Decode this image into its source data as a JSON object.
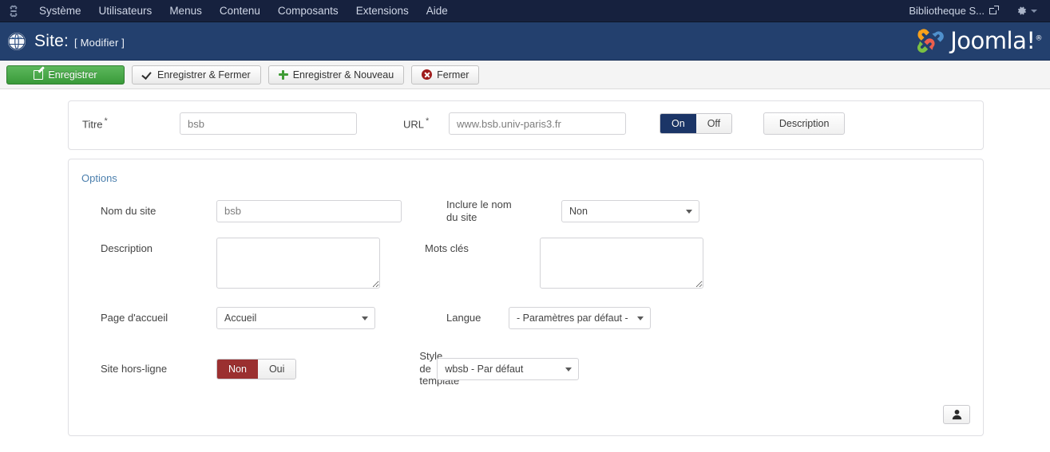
{
  "topbar": {
    "brand_icon": "joomla-mark-icon",
    "menu": [
      {
        "label": "Système"
      },
      {
        "label": "Utilisateurs"
      },
      {
        "label": "Menus"
      },
      {
        "label": "Contenu"
      },
      {
        "label": "Composants"
      },
      {
        "label": "Extensions"
      },
      {
        "label": "Aide"
      }
    ],
    "site_link": "Bibliotheque S...",
    "site_link_icon": "external-link-icon",
    "gear_icon": "gear-icon",
    "caret_icon": "chevron-down-icon",
    "bg_color": "#16213e"
  },
  "header": {
    "icon": "globe-icon",
    "title": "Site:",
    "subtitle": "[ Modifier ]",
    "logo_text": "Joomla!",
    "logo_sup": "®",
    "bg_color": "#23406e"
  },
  "toolbar": {
    "save": {
      "label": "Enregistrer",
      "icon": "edit-icon"
    },
    "save_close": {
      "label": "Enregistrer & Fermer",
      "icon": "check-icon"
    },
    "save_new": {
      "label": "Enregistrer & Nouveau",
      "icon": "plus-icon"
    },
    "close": {
      "label": "Fermer",
      "icon": "close-circle-icon"
    },
    "save_color": "#3a9a3a"
  },
  "top_panel": {
    "title_label": "Titre",
    "title_required": "*",
    "title_value": "bsb",
    "url_label": "URL",
    "url_required": "*",
    "url_value": "www.bsb.univ-paris3.fr",
    "toggle_on": "On",
    "toggle_off": "Off",
    "toggle_state": "On",
    "description_button": "Description",
    "on_color": "#1b3567"
  },
  "options": {
    "tab_label": "Options",
    "site_name_label": "Nom du site",
    "site_name_value": "bsb",
    "include_site_name_label": "Inclure le nom du site",
    "include_site_name_value": "Non",
    "description_label": "Description",
    "description_value": "",
    "keywords_label": "Mots clés",
    "keywords_value": "",
    "home_page_label": "Page d'accueil",
    "home_page_value": "Accueil",
    "language_label": "Langue",
    "language_value": "- Paramètres par défaut -",
    "offline_label": "Site hors-ligne",
    "offline_no": "Non",
    "offline_yes": "Oui",
    "offline_state": "Non",
    "offline_color": "#9b3030",
    "template_style_label": "Style de template",
    "template_style_value": "wbsb - Par défaut",
    "user_button_icon": "user-icon"
  }
}
